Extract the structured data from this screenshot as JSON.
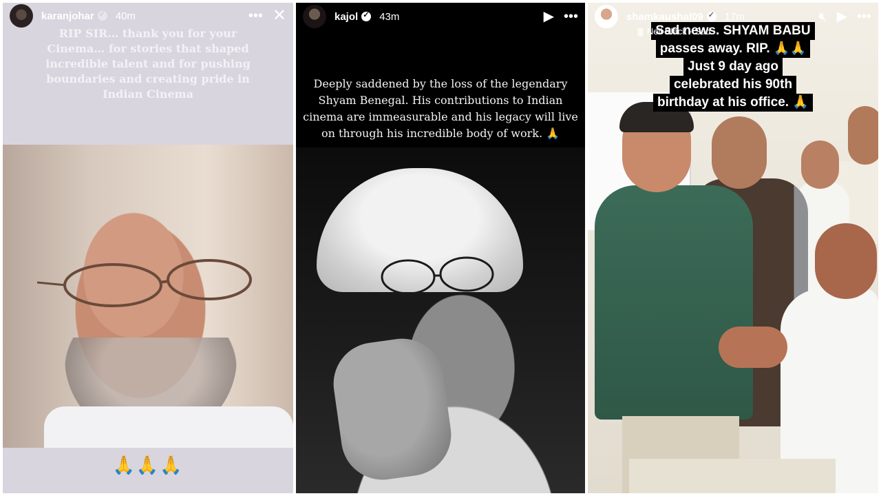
{
  "stories": [
    {
      "username": "karanjohar",
      "time": "40m",
      "more_icon": "more-horizontal-icon",
      "close_icon": "close-icon",
      "caption": "RIP SIR… thank you for your Cinema… for stories that shaped incredible talent and for pushing boundaries and creating pride in Indian Cinema",
      "emoji_footer": "🙏🙏🙏"
    },
    {
      "username": "kajol",
      "time": "43m",
      "play_icon": "play-icon",
      "more_icon": "more-horizontal-icon",
      "caption": "Deeply saddened by the loss of the legendary Shyam Benegal. His contributions to Indian cinema are immeasurable and his legacy will live on through his incredible body of work. 🙏"
    },
    {
      "username": "shamkaushal09",
      "time": "17m",
      "music": "Neil Black · Sad",
      "mute_icon": "volume-muted-icon",
      "play_icon": "play-icon",
      "more_icon": "more-horizontal-icon",
      "caption_lines": [
        "Sad news. SHYAM BABU",
        "passes away. RIP. 🙏🙏",
        "Just 9 day ago",
        "celebrated his 90th",
        "birthday at his office. 🙏"
      ]
    }
  ]
}
